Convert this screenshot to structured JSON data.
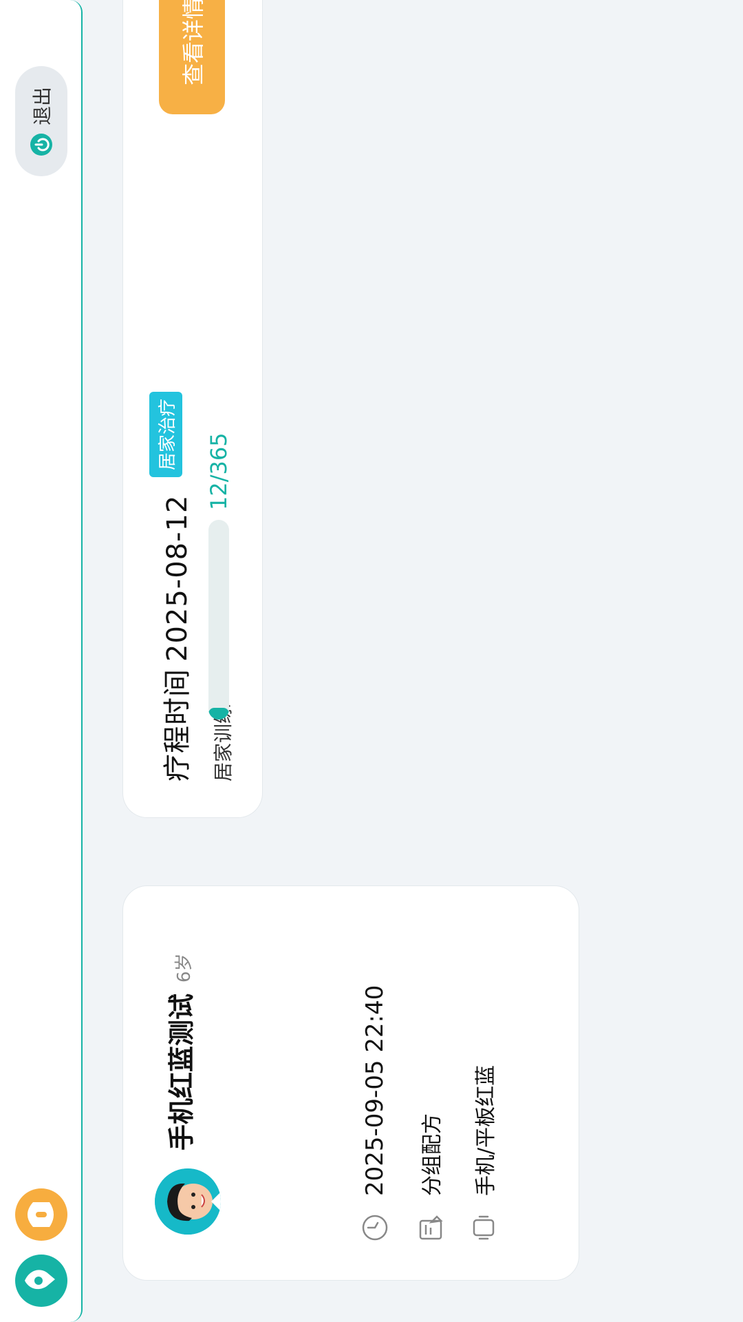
{
  "header": {
    "logout_label": "退出",
    "icons": [
      "app-logo-teal-icon",
      "app-logo-orange-icon",
      "power-icon"
    ]
  },
  "patient": {
    "name": "手机红蓝测试",
    "age": "6岁",
    "datetime": "2025-09-05 22:40",
    "group": "分组配方",
    "device": "手机/平板红蓝",
    "icons": [
      "avatar",
      "clock-icon",
      "formula-icon",
      "device-icon"
    ]
  },
  "schedule": {
    "title_prefix": "疗程时间",
    "date": "2025-08-12",
    "tag": "居家治疗",
    "training_label": "居家训练",
    "progress_text": "12/365",
    "progress_fraction": 0.033,
    "detail_button": "查看详情"
  },
  "colors": {
    "accent": "#16b3a5",
    "orange": "#f7b045",
    "tag": "#23c3de",
    "background": "#f1f4f7"
  }
}
